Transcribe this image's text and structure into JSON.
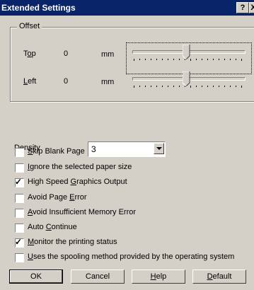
{
  "window": {
    "title": "Extended Settings",
    "help_button": "?",
    "close_button": "X"
  },
  "offset_group": {
    "title": "Offset",
    "top": {
      "label_prefix": "T",
      "label_mnemonic": "o",
      "label_suffix": "p",
      "value": "0",
      "unit": "mm",
      "slider_level": 0.5
    },
    "left": {
      "label_mnemonic": "L",
      "label_suffix": "eft",
      "value": "0",
      "unit": "mm",
      "slider_level": 0.5
    }
  },
  "density": {
    "label_prefix": "Den",
    "label_mnemonic": "s",
    "label_suffix": "ity",
    "value": "3"
  },
  "options": [
    {
      "pre": "",
      "mn": "S",
      "post": "kip Blank Page",
      "checked": false
    },
    {
      "pre": "",
      "mn": "I",
      "post": "gnore the selected paper size",
      "checked": false
    },
    {
      "pre": "High Speed ",
      "mn": "G",
      "post": "raphics Output",
      "checked": true
    },
    {
      "pre": "Avoid Page ",
      "mn": "E",
      "post": "rror",
      "checked": false
    },
    {
      "pre": "",
      "mn": "A",
      "post": "void Insufficient Memory Error",
      "checked": false
    },
    {
      "pre": "Auto ",
      "mn": "C",
      "post": "ontinue",
      "checked": false
    },
    {
      "pre": "",
      "mn": "M",
      "post": "onitor the printing status",
      "checked": true
    },
    {
      "pre": "",
      "mn": "U",
      "post": "ses the spooling method provided by the operating system",
      "checked": false
    }
  ],
  "buttons": {
    "ok": "OK",
    "cancel": "Cancel",
    "help_mnemonic": "H",
    "help_rest": "elp",
    "default_mnemonic": "D",
    "default_rest": "efault"
  }
}
